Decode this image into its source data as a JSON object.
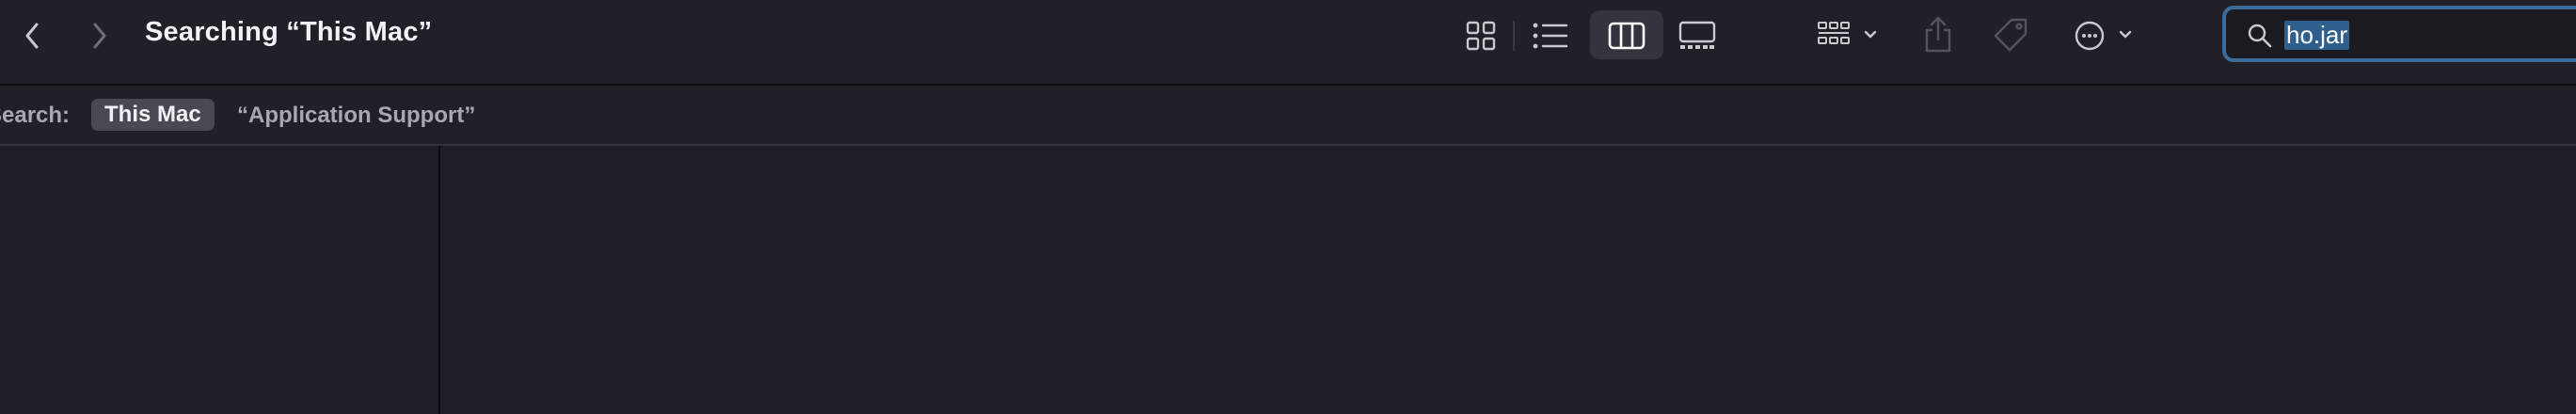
{
  "window": {
    "title": "Searching “This Mac”"
  },
  "toolbar": {
    "back_icon": "chevron-left-icon",
    "forward_icon": "chevron-right-icon",
    "view_modes": [
      "icon-view",
      "list-view",
      "column-view",
      "gallery-view"
    ],
    "selected_view": "column-view",
    "group_icon": "group-grid-icon",
    "share_icon": "share-icon",
    "tag_icon": "tag-icon",
    "more_icon": "ellipsis-circle-icon"
  },
  "search": {
    "query": "ho.jar",
    "icon": "magnifier-icon"
  },
  "scope_bar": {
    "label": "Search:",
    "this_mac": "This Mac",
    "folder": "“Application Support”"
  },
  "colors": {
    "background": "#1f1d26",
    "toolbar": "#211f28",
    "search_focus_ring": "#3c6a9a",
    "selection": "#2f5f8c"
  }
}
